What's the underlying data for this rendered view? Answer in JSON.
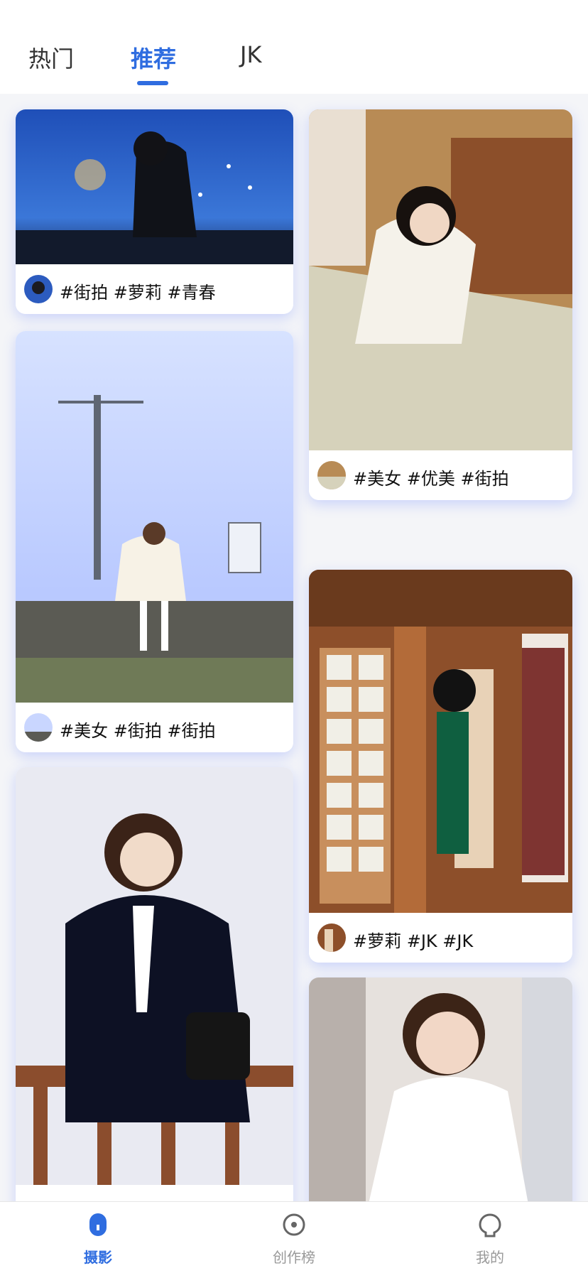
{
  "tabs": [
    {
      "label": "热门"
    },
    {
      "label": "推荐"
    },
    {
      "label": "JK"
    }
  ],
  "active_tab": "推荐",
  "feed": {
    "cards": [
      {
        "tags": "#街拍 #萝莉 #青春"
      },
      {
        "tags": "#美女 #优美 #街拍"
      },
      {
        "tags": "#美女 #街拍 #街拍"
      },
      {
        "tags": "#萝莉 #JK #JK"
      },
      {
        "tags": ""
      },
      {
        "tags": ""
      }
    ]
  },
  "bottom_nav": [
    {
      "label": "摄影"
    },
    {
      "label": "创作榜"
    },
    {
      "label": "我的"
    }
  ],
  "colors": {
    "accent": "#2f6de0",
    "shadow": "#6c86ff"
  }
}
